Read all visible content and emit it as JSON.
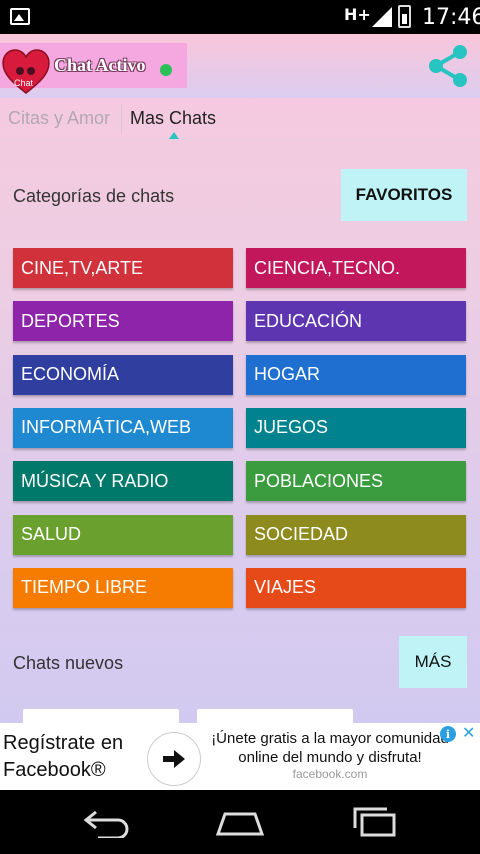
{
  "status_bar": {
    "network": "H+",
    "time": "17:46"
  },
  "header": {
    "app_title": "Chat Activo",
    "logo_text": "Chat"
  },
  "tabs": [
    {
      "label": "Citas y Amor",
      "selected": false
    },
    {
      "label": "Mas Chats",
      "selected": true
    }
  ],
  "categories_section": {
    "title": "Categorías de chats",
    "favorites_label": "FAVORITOS"
  },
  "categories": [
    {
      "label": "CINE,TV,ARTE",
      "color": "#d0313b"
    },
    {
      "label": "CIENCIA,TECNO.",
      "color": "#c2185b"
    },
    {
      "label": "DEPORTES",
      "color": "#8e24aa"
    },
    {
      "label": "EDUCACIÓN",
      "color": "#5e35b1"
    },
    {
      "label": "ECONOMÍA",
      "color": "#303f9f"
    },
    {
      "label": "HOGAR",
      "color": "#1e6fd0"
    },
    {
      "label": "INFORMÁTICA,WEB",
      "color": "#1e88d0"
    },
    {
      "label": "JUEGOS",
      "color": "#00838f"
    },
    {
      "label": "MÚSICA Y RADIO",
      "color": "#00796b"
    },
    {
      "label": "POBLACIONES",
      "color": "#3a9b3f"
    },
    {
      "label": "SALUD",
      "color": "#6aa12e"
    },
    {
      "label": "SOCIEDAD",
      "color": "#8d8a1e"
    },
    {
      "label": "TIEMPO LIBRE",
      "color": "#f57c00"
    },
    {
      "label": "VIAJES",
      "color": "#e64a19"
    }
  ],
  "new_chats_section": {
    "title": "Chats nuevos",
    "more_label": "MÁS"
  },
  "ad": {
    "left_text": "Regístrate en Facebook®",
    "headline": "¡Únete gratis a la mayor comunidad online del mundo y disfruta!",
    "domain": "facebook.com"
  }
}
